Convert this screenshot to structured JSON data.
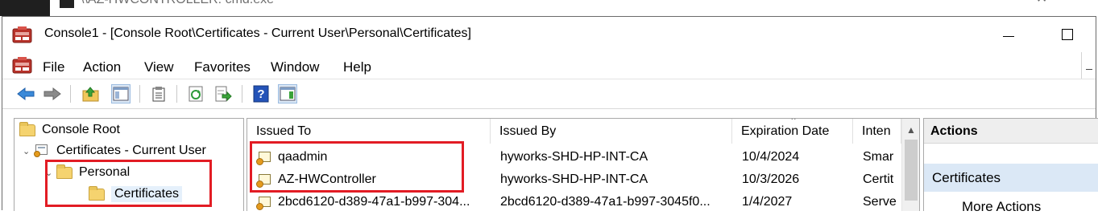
{
  "background_window": {
    "title": "\\\\AZ-HWCONTROLLER: cmd.exe"
  },
  "window": {
    "title": "Console1 - [Console Root\\Certificates - Current User\\Personal\\Certificates]",
    "icon": "console-icon"
  },
  "menu": [
    "File",
    "Action",
    "View",
    "Favorites",
    "Window",
    "Help"
  ],
  "toolbar": {
    "buttons": [
      "back-arrow-icon",
      "forward-arrow-icon",
      "up-folder-icon",
      "show-hide-tree-icon",
      "properties-icon",
      "refresh-icon",
      "export-list-icon",
      "help-icon",
      "show-action-pane-icon"
    ]
  },
  "tree": {
    "items": [
      {
        "label": "Console Root",
        "level": 0
      },
      {
        "label": "Certificates - Current User",
        "level": 1,
        "expanded": true
      },
      {
        "label": "Personal",
        "level": 2,
        "expanded": true
      },
      {
        "label": "Certificates",
        "level": 3,
        "selected": true
      }
    ]
  },
  "list": {
    "columns": [
      "Issued To",
      "Issued By",
      "Expiration Date",
      "Inten"
    ],
    "rows": [
      {
        "issued_to": "qaadmin",
        "issued_by": "hyworks-SHD-HP-INT-CA",
        "expiration": "10/4/2024",
        "intended": "Smar"
      },
      {
        "issued_to": "AZ-HWController",
        "issued_by": "hyworks-SHD-HP-INT-CA",
        "expiration": "10/3/2026",
        "intended": "Certit"
      },
      {
        "issued_to": "2bcd6120-d389-47a1-b997-304...",
        "issued_by": "2bcd6120-d389-47a1-b997-3045f0...",
        "expiration": "1/4/2027",
        "intended": "Serve"
      }
    ]
  },
  "actions": {
    "header": "Actions",
    "group": "Certificates",
    "item": "More Actions"
  },
  "colors": {
    "highlight_box": "#e21c24",
    "selection": "#dbe8f6"
  }
}
